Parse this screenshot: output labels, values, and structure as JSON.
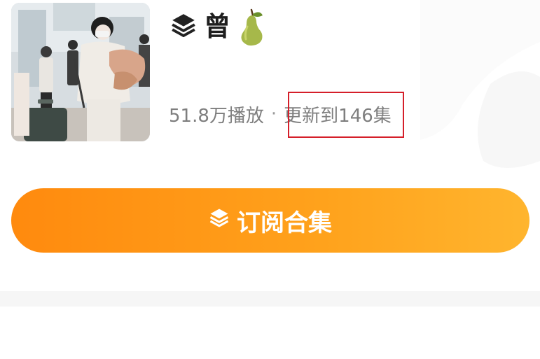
{
  "collection": {
    "title": "曾",
    "title_emoji_icon": "pear-icon",
    "collection_icon": "stack-layers-icon",
    "play_count": "51.8万播放",
    "separator": "·",
    "update_status": "更新到146集"
  },
  "subscribe_button": {
    "label": "订阅合集",
    "icon": "stack-layers-icon"
  },
  "colors": {
    "accent_start": "#ff8a0e",
    "accent_end": "#ffb52e",
    "highlight_border": "#d51f2a",
    "meta_text": "#7e7e7e",
    "title_text": "#1e1e1e"
  }
}
